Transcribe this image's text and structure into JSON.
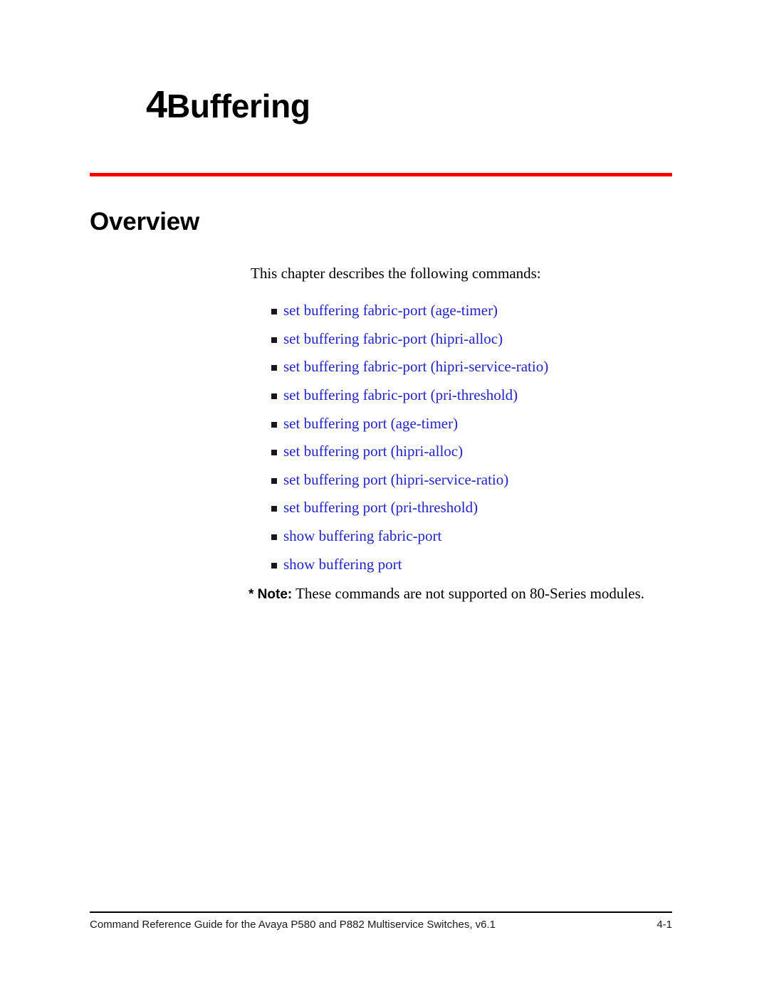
{
  "chapter": {
    "number": "4",
    "title": "Buffering"
  },
  "section": {
    "heading": "Overview",
    "intro": "This chapter describes the following commands:"
  },
  "commands": [
    {
      "label": "set buffering fabric-port (age-timer)"
    },
    {
      "label": "set buffering fabric-port (hipri-alloc)"
    },
    {
      "label": "set buffering fabric-port (hipri-service-ratio)"
    },
    {
      "label": "set buffering fabric-port (pri-threshold)"
    },
    {
      "label": "set buffering port (age-timer)"
    },
    {
      "label": "set buffering port (hipri-alloc)"
    },
    {
      "label": "set buffering port (hipri-service-ratio)"
    },
    {
      "label": "set buffering port (pri-threshold)"
    },
    {
      "label": "show buffering fabric-port"
    },
    {
      "label": "show buffering port"
    }
  ],
  "note": {
    "label": "* Note:",
    "text": " These commands are not supported on 80-Series modules."
  },
  "footer": {
    "text": "Command Reference Guide for the Avaya P580 and P882 Multiservice Switches, v6.1",
    "page": "4-1"
  },
  "colors": {
    "rule_red": "#ff0000",
    "link_blue": "#2222cc",
    "bullet": "#18181c",
    "text": "#000000",
    "background": "#ffffff"
  }
}
